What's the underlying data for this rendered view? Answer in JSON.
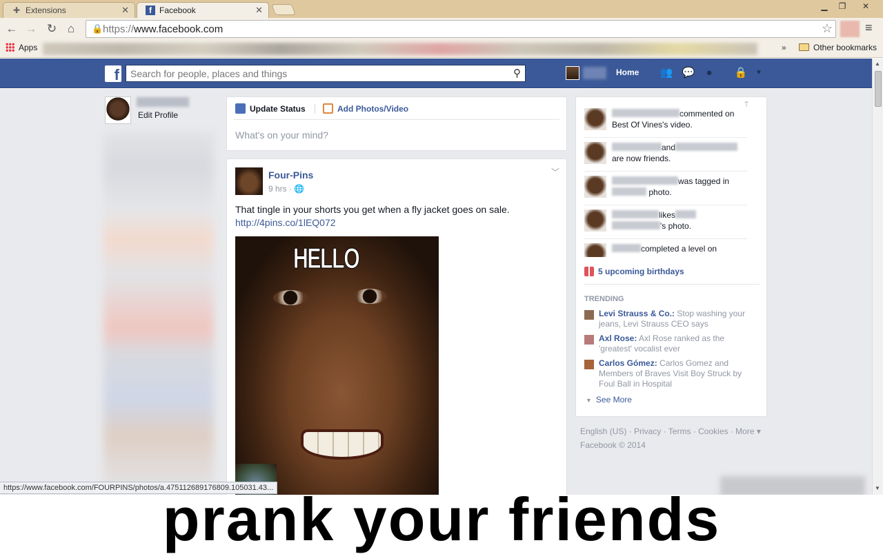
{
  "browser": {
    "tabs": [
      {
        "label": "Extensions",
        "icon": "puzzle-icon"
      },
      {
        "label": "Facebook",
        "icon": "facebook-icon"
      }
    ],
    "url": {
      "scheme": "https://",
      "host": "www.facebook.com"
    },
    "bookmarks": {
      "apps_label": "Apps",
      "more_label": "»",
      "other_label": "Other bookmarks"
    },
    "status_url": "https://www.facebook.com/FOURPINS/photos/a.475112689176809.105031.43..."
  },
  "facebook": {
    "logo": "f",
    "search_placeholder": "Search for people, places and things",
    "nav_home": "Home",
    "left": {
      "edit_profile": "Edit Profile"
    },
    "composer": {
      "update_status": "Update Status",
      "add_photos": "Add Photos/Video",
      "placeholder": "What's on your mind?"
    },
    "post": {
      "author": "Four-Pins",
      "time": "9 hrs",
      "text": "That tingle in your shorts you get when a fly jacket goes on sale.",
      "link": "http://4pins.co/1lEQ072",
      "image_text": "HELLO"
    },
    "ticker": [
      {
        "t1": "commented on",
        "t2": "Best Of Vines's video."
      },
      {
        "t1": "and",
        "t2": "are now friends."
      },
      {
        "t1": "was tagged in",
        "t2": "photo."
      },
      {
        "t1": "likes",
        "t2": "'s photo."
      },
      {
        "t1": "completed a level on",
        "t2": ""
      }
    ],
    "birthdays": "5 upcoming birthdays",
    "trending": {
      "heading": "TRENDING",
      "items": [
        {
          "topic": "Levi Strauss & Co.:",
          "text": "Stop washing your jeans, Levi Strauss CEO says"
        },
        {
          "topic": "Axl Rose:",
          "text": "Axl Rose ranked as the 'greatest' vocalist ever"
        },
        {
          "topic": "Carlos Gómez:",
          "text": "Carlos Gomez and Members of Braves Visit Boy Struck by Foul Ball in Hospital"
        }
      ],
      "see_more": "See More"
    },
    "footer": {
      "line1": "English (US) · Privacy · Terms · Cookies · More ▾",
      "line2": "Facebook © 2014"
    }
  },
  "caption": "prank your friends",
  "colors": {
    "fb_blue": "#3b5998",
    "chrome_tan": "#dfc89e"
  }
}
